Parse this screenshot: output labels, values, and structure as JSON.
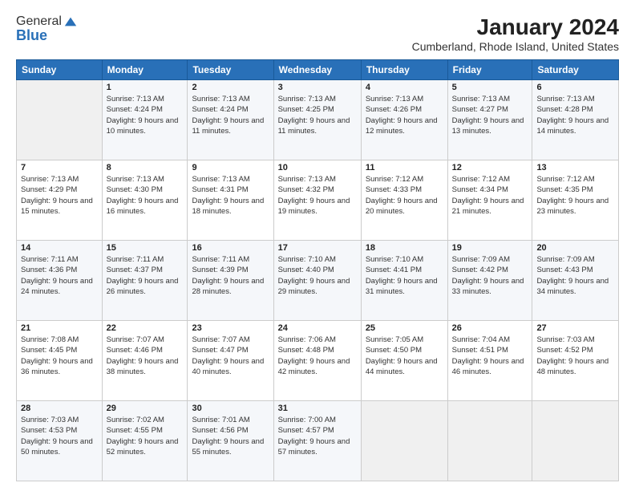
{
  "header": {
    "logo_line1": "General",
    "logo_line2": "Blue",
    "title": "January 2024",
    "subtitle": "Cumberland, Rhode Island, United States"
  },
  "columns": [
    "Sunday",
    "Monday",
    "Tuesday",
    "Wednesday",
    "Thursday",
    "Friday",
    "Saturday"
  ],
  "weeks": [
    [
      {
        "day": "",
        "sunrise": "",
        "sunset": "",
        "daylight": ""
      },
      {
        "day": "1",
        "sunrise": "Sunrise: 7:13 AM",
        "sunset": "Sunset: 4:24 PM",
        "daylight": "Daylight: 9 hours and 10 minutes."
      },
      {
        "day": "2",
        "sunrise": "Sunrise: 7:13 AM",
        "sunset": "Sunset: 4:24 PM",
        "daylight": "Daylight: 9 hours and 11 minutes."
      },
      {
        "day": "3",
        "sunrise": "Sunrise: 7:13 AM",
        "sunset": "Sunset: 4:25 PM",
        "daylight": "Daylight: 9 hours and 11 minutes."
      },
      {
        "day": "4",
        "sunrise": "Sunrise: 7:13 AM",
        "sunset": "Sunset: 4:26 PM",
        "daylight": "Daylight: 9 hours and 12 minutes."
      },
      {
        "day": "5",
        "sunrise": "Sunrise: 7:13 AM",
        "sunset": "Sunset: 4:27 PM",
        "daylight": "Daylight: 9 hours and 13 minutes."
      },
      {
        "day": "6",
        "sunrise": "Sunrise: 7:13 AM",
        "sunset": "Sunset: 4:28 PM",
        "daylight": "Daylight: 9 hours and 14 minutes."
      }
    ],
    [
      {
        "day": "7",
        "sunrise": "Sunrise: 7:13 AM",
        "sunset": "Sunset: 4:29 PM",
        "daylight": "Daylight: 9 hours and 15 minutes."
      },
      {
        "day": "8",
        "sunrise": "Sunrise: 7:13 AM",
        "sunset": "Sunset: 4:30 PM",
        "daylight": "Daylight: 9 hours and 16 minutes."
      },
      {
        "day": "9",
        "sunrise": "Sunrise: 7:13 AM",
        "sunset": "Sunset: 4:31 PM",
        "daylight": "Daylight: 9 hours and 18 minutes."
      },
      {
        "day": "10",
        "sunrise": "Sunrise: 7:13 AM",
        "sunset": "Sunset: 4:32 PM",
        "daylight": "Daylight: 9 hours and 19 minutes."
      },
      {
        "day": "11",
        "sunrise": "Sunrise: 7:12 AM",
        "sunset": "Sunset: 4:33 PM",
        "daylight": "Daylight: 9 hours and 20 minutes."
      },
      {
        "day": "12",
        "sunrise": "Sunrise: 7:12 AM",
        "sunset": "Sunset: 4:34 PM",
        "daylight": "Daylight: 9 hours and 21 minutes."
      },
      {
        "day": "13",
        "sunrise": "Sunrise: 7:12 AM",
        "sunset": "Sunset: 4:35 PM",
        "daylight": "Daylight: 9 hours and 23 minutes."
      }
    ],
    [
      {
        "day": "14",
        "sunrise": "Sunrise: 7:11 AM",
        "sunset": "Sunset: 4:36 PM",
        "daylight": "Daylight: 9 hours and 24 minutes."
      },
      {
        "day": "15",
        "sunrise": "Sunrise: 7:11 AM",
        "sunset": "Sunset: 4:37 PM",
        "daylight": "Daylight: 9 hours and 26 minutes."
      },
      {
        "day": "16",
        "sunrise": "Sunrise: 7:11 AM",
        "sunset": "Sunset: 4:39 PM",
        "daylight": "Daylight: 9 hours and 28 minutes."
      },
      {
        "day": "17",
        "sunrise": "Sunrise: 7:10 AM",
        "sunset": "Sunset: 4:40 PM",
        "daylight": "Daylight: 9 hours and 29 minutes."
      },
      {
        "day": "18",
        "sunrise": "Sunrise: 7:10 AM",
        "sunset": "Sunset: 4:41 PM",
        "daylight": "Daylight: 9 hours and 31 minutes."
      },
      {
        "day": "19",
        "sunrise": "Sunrise: 7:09 AM",
        "sunset": "Sunset: 4:42 PM",
        "daylight": "Daylight: 9 hours and 33 minutes."
      },
      {
        "day": "20",
        "sunrise": "Sunrise: 7:09 AM",
        "sunset": "Sunset: 4:43 PM",
        "daylight": "Daylight: 9 hours and 34 minutes."
      }
    ],
    [
      {
        "day": "21",
        "sunrise": "Sunrise: 7:08 AM",
        "sunset": "Sunset: 4:45 PM",
        "daylight": "Daylight: 9 hours and 36 minutes."
      },
      {
        "day": "22",
        "sunrise": "Sunrise: 7:07 AM",
        "sunset": "Sunset: 4:46 PM",
        "daylight": "Daylight: 9 hours and 38 minutes."
      },
      {
        "day": "23",
        "sunrise": "Sunrise: 7:07 AM",
        "sunset": "Sunset: 4:47 PM",
        "daylight": "Daylight: 9 hours and 40 minutes."
      },
      {
        "day": "24",
        "sunrise": "Sunrise: 7:06 AM",
        "sunset": "Sunset: 4:48 PM",
        "daylight": "Daylight: 9 hours and 42 minutes."
      },
      {
        "day": "25",
        "sunrise": "Sunrise: 7:05 AM",
        "sunset": "Sunset: 4:50 PM",
        "daylight": "Daylight: 9 hours and 44 minutes."
      },
      {
        "day": "26",
        "sunrise": "Sunrise: 7:04 AM",
        "sunset": "Sunset: 4:51 PM",
        "daylight": "Daylight: 9 hours and 46 minutes."
      },
      {
        "day": "27",
        "sunrise": "Sunrise: 7:03 AM",
        "sunset": "Sunset: 4:52 PM",
        "daylight": "Daylight: 9 hours and 48 minutes."
      }
    ],
    [
      {
        "day": "28",
        "sunrise": "Sunrise: 7:03 AM",
        "sunset": "Sunset: 4:53 PM",
        "daylight": "Daylight: 9 hours and 50 minutes."
      },
      {
        "day": "29",
        "sunrise": "Sunrise: 7:02 AM",
        "sunset": "Sunset: 4:55 PM",
        "daylight": "Daylight: 9 hours and 52 minutes."
      },
      {
        "day": "30",
        "sunrise": "Sunrise: 7:01 AM",
        "sunset": "Sunset: 4:56 PM",
        "daylight": "Daylight: 9 hours and 55 minutes."
      },
      {
        "day": "31",
        "sunrise": "Sunrise: 7:00 AM",
        "sunset": "Sunset: 4:57 PM",
        "daylight": "Daylight: 9 hours and 57 minutes."
      },
      {
        "day": "",
        "sunrise": "",
        "sunset": "",
        "daylight": ""
      },
      {
        "day": "",
        "sunrise": "",
        "sunset": "",
        "daylight": ""
      },
      {
        "day": "",
        "sunrise": "",
        "sunset": "",
        "daylight": ""
      }
    ]
  ]
}
